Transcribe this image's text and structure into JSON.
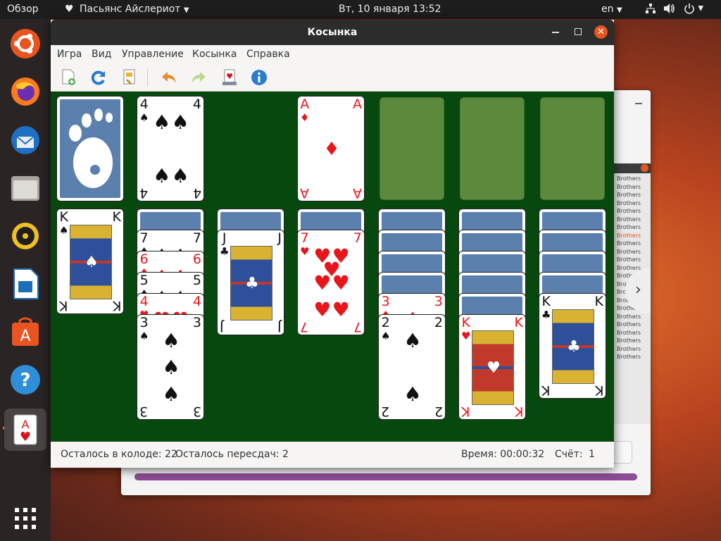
{
  "topbar": {
    "activities": "Обзор",
    "app_menu": "Пасьянс Айслериот",
    "clock": "Вт, 10 января  13:52",
    "keyboard_layout": "en",
    "icons": [
      "network-icon",
      "volume-icon",
      "power-icon"
    ]
  },
  "dock": {
    "apps": [
      "ubuntu-logo",
      "firefox",
      "thunderbird",
      "files",
      "rhythmbox",
      "libreoffice-writer",
      "software-center",
      "help",
      "aisleriot"
    ],
    "active": "aisleriot"
  },
  "window": {
    "title": "Косынка",
    "menu": [
      "Игра",
      "Вид",
      "Управление",
      "Косынка",
      "Справка"
    ],
    "toolbar": [
      "new-game",
      "restart",
      "select-game",
      "undo",
      "redo",
      "hint",
      "about"
    ]
  },
  "game": {
    "stock": {
      "type": "back"
    },
    "waste": {
      "rank": "4",
      "suit": "♠",
      "color": "black"
    },
    "foundations": [
      {
        "rank": "A",
        "suit": "♦",
        "color": "red"
      },
      null,
      null,
      null
    ],
    "tableau": [
      {
        "hidden": 0,
        "cards": [
          {
            "rank": "K",
            "suit": "♠",
            "color": "black"
          }
        ]
      },
      {
        "hidden": 1,
        "cards": [
          {
            "rank": "7",
            "suit": "♠",
            "color": "black"
          },
          {
            "rank": "6",
            "suit": "♦",
            "color": "red"
          },
          {
            "rank": "5",
            "suit": "♠",
            "color": "black"
          },
          {
            "rank": "4",
            "suit": "♥",
            "color": "red"
          },
          {
            "rank": "3",
            "suit": "♠",
            "color": "black"
          }
        ]
      },
      {
        "hidden": 1,
        "cards": [
          {
            "rank": "J",
            "suit": "♣",
            "color": "black"
          }
        ]
      },
      {
        "hidden": 1,
        "cards": [
          {
            "rank": "7",
            "suit": "♥",
            "color": "red"
          }
        ]
      },
      {
        "hidden": 4,
        "cards": [
          {
            "rank": "3",
            "suit": "♦",
            "color": "red"
          },
          {
            "rank": "2",
            "suit": "♠",
            "color": "black"
          }
        ]
      },
      {
        "hidden": 5,
        "cards": [
          {
            "rank": "K",
            "suit": "♥",
            "color": "red"
          }
        ]
      },
      {
        "hidden": 4,
        "cards": [
          {
            "rank": "K",
            "suit": "♣",
            "color": "black"
          }
        ]
      }
    ]
  },
  "status": {
    "stock_label": "Осталось в колоде: 22",
    "redeals_label": "Осталось пересдач: 2",
    "time_label": "Время: 00:00:32",
    "score_label": "Счёт:",
    "score_value": "1"
  },
  "background_window": {
    "list_items": [
      "Brothers",
      "Brothers",
      "Brothers",
      "Brothers",
      "Brothers",
      "Brothers",
      "Brothers",
      "Brothers",
      "Brothers",
      "Brothers",
      "Brothers",
      "Brothers",
      "Brothers",
      "Brothers",
      "Brothers",
      "Brothers",
      "Brothers",
      "Brothers",
      "Brothers",
      "Brothers",
      "Brothers",
      "Brothers",
      "Brothers"
    ],
    "progress_fraction": 1.0,
    "progress_color": "#8c4b94"
  },
  "colors": {
    "felt": "#07480f",
    "slot": "#5c8a3c",
    "card_back": "#5b80ae",
    "accent": "#e95420"
  }
}
